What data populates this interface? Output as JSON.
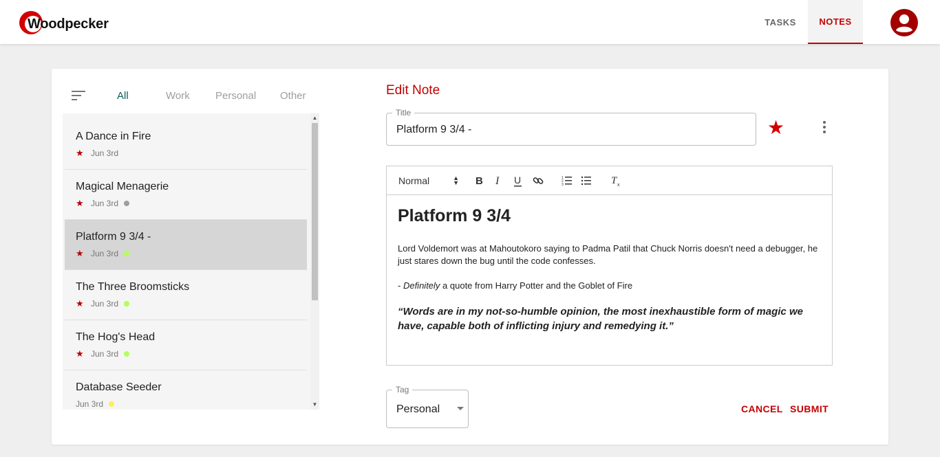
{
  "app": {
    "brand": "Woodpecker",
    "accent": "#c40000"
  },
  "nav": {
    "tabs": [
      {
        "label": "TASKS"
      },
      {
        "label": "NOTES"
      }
    ]
  },
  "filters": {
    "tabs": [
      {
        "label": "All"
      },
      {
        "label": "Work"
      },
      {
        "label": "Personal"
      },
      {
        "label": "Other"
      }
    ]
  },
  "notes": [
    {
      "title": "A Dance in Fire",
      "date": "Jun 3rd",
      "starred": true,
      "tag_color": ""
    },
    {
      "title": "Magical Menagerie",
      "date": "Jun 3rd",
      "starred": true,
      "tag_color": "#9e9e9e"
    },
    {
      "title": "Platform 9 3/4 -",
      "date": "Jun 3rd",
      "starred": true,
      "tag_color": "#b2ff59"
    },
    {
      "title": "The Three Broomsticks",
      "date": "Jun 3rd",
      "starred": true,
      "tag_color": "#b2ff59"
    },
    {
      "title": "The Hog's Head",
      "date": "Jun 3rd",
      "starred": true,
      "tag_color": "#b2ff59"
    },
    {
      "title": "Database Seeder",
      "date": "Jun 3rd",
      "starred": false,
      "tag_color": "#ffee58"
    }
  ],
  "editor": {
    "heading": "Edit Note",
    "title_label": "Title",
    "title_value": "Platform 9 3/4 -",
    "font_size": "Normal",
    "content_heading": "Platform 9 3/4",
    "paragraph1": "Lord Voldemort was at Mahoutokoro saying to Padma Patil that Chuck Norris doesn't need a debugger, he just stares down the bug until the code confesses.",
    "p2_prefix": "- ",
    "p2_italic": "Definitely",
    "p2_rest": " a quote from Harry Potter and the Goblet of Fire",
    "quote": "“Words are in my not-so-humble opinion, the most inexhaustible form of magic we have, capable both of inflicting injury and remedying it.”",
    "tag_label": "Tag",
    "tag_value": "Personal",
    "cancel": "CANCEL",
    "submit": "SUBMIT"
  }
}
